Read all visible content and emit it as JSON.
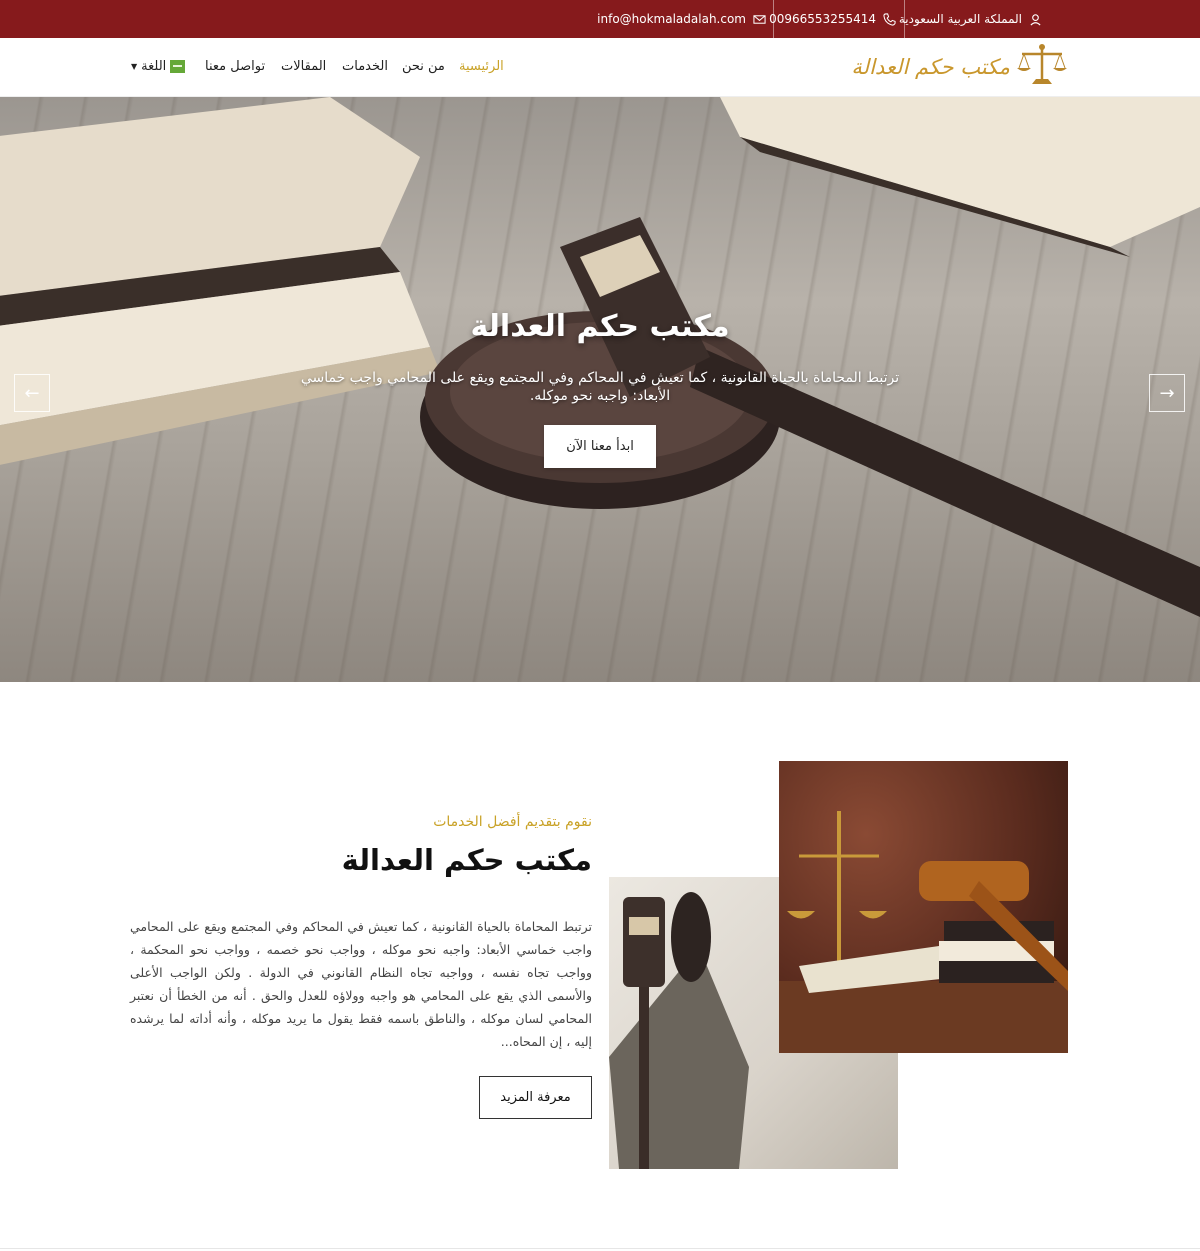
{
  "topbar": {
    "location": "المملكة العربية السعودية",
    "phone": "00966553255414",
    "email": "info@hokmaladalah.com"
  },
  "header": {
    "logo_text": "مكتب حكم العدالة",
    "nav": {
      "home": "الرئيسية",
      "about": "من نحن",
      "services": "الخدمات",
      "articles": "المقالات",
      "contact": "تواصل معنا",
      "language": "اللغة"
    }
  },
  "hero": {
    "title": "مكتب حكم العدالة",
    "subtitle": "ترتبط المحاماة بالحياة القانونية ، كما تعيش في المحاكم وفي المجتمع ويقع على المحامي واجب خماسي الأبعاد: واجبه نحو موكله.",
    "cta": "ابدأ معنا الآن",
    "prev": "←",
    "next": "→"
  },
  "about": {
    "subtitle": "نقوم بتقديم أفضل الخدمات",
    "title": "مكتب حكم العدالة",
    "body": "ترتبط المحاماة بالحياة القانونية ، كما تعيش في المحاكم وفي المجتمع ويقع على المحامي واجب خماسي الأبعاد: واجبه نحو موكله ، وواجب نحو خصمه ، وواجب نحو المحكمة ، وواجب تجاه نفسه ، وواجبه تجاه النظام القانوني في الدولة . ولكن الواجب الأعلى والأسمى الذي يقع على المحامي هو واجبه وولاؤه للعدل والحق . أنه من الخطأ أن نعتبر المحامي لسان موكله ، والناطق باسمه فقط يقول ما يريد موكله ، وأنه أداته لما يرشده إليه ، إن المحاه...",
    "more": "معرفة المزيد"
  },
  "colors": {
    "topbar": "#861a1c",
    "accent": "#c9a227",
    "logo": "#c9972d"
  }
}
